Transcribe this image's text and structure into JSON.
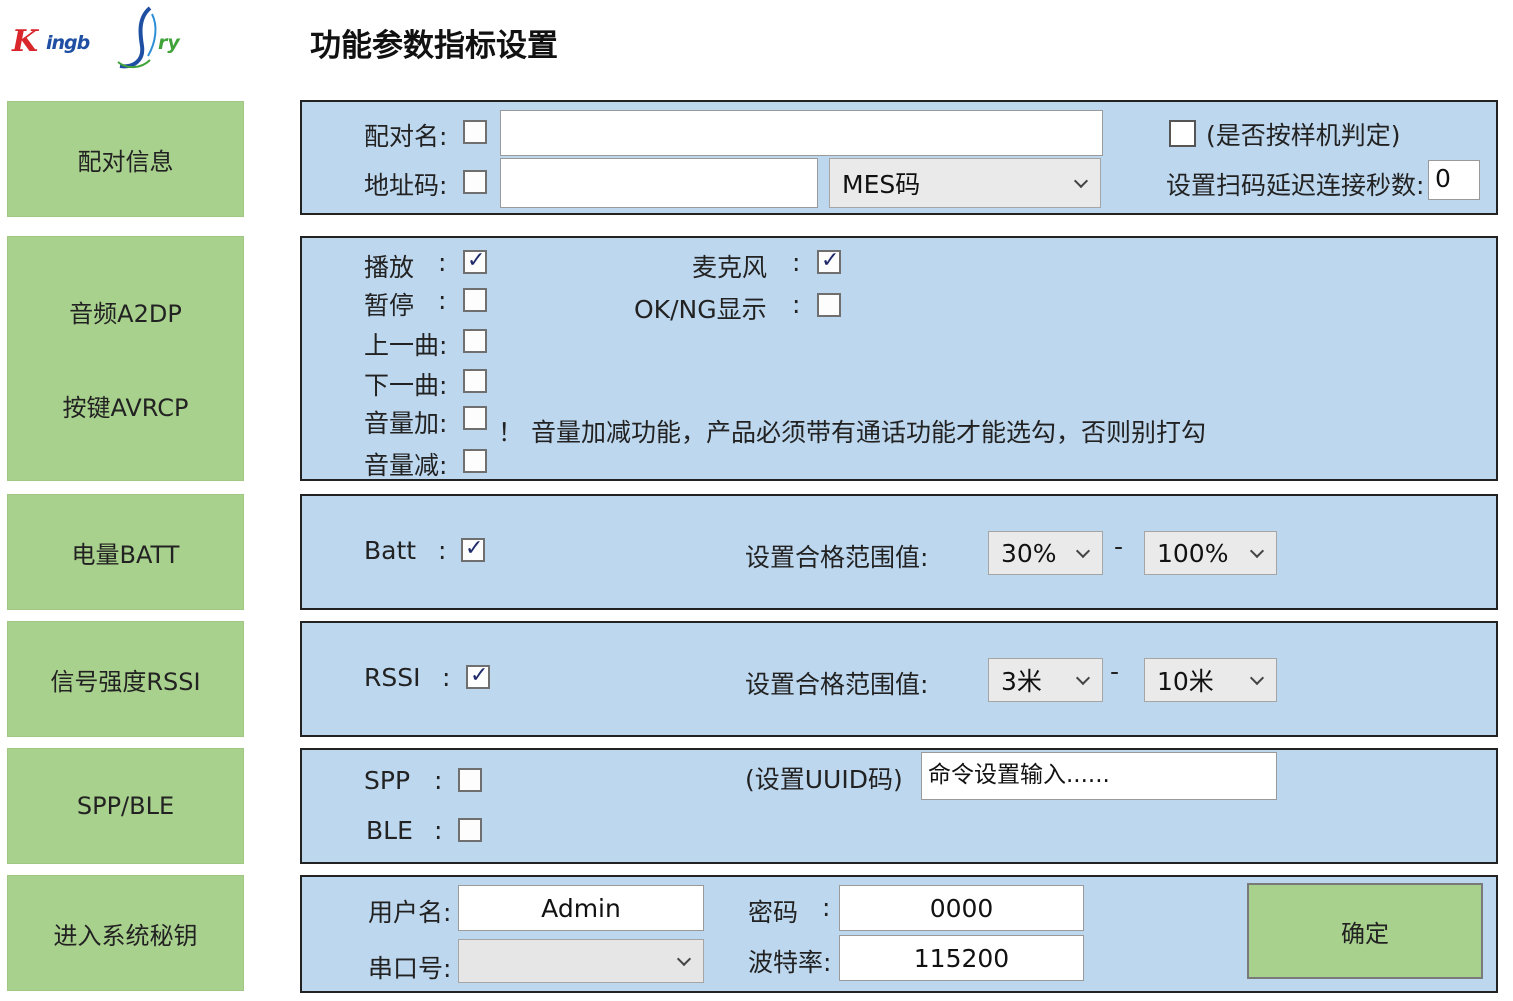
{
  "logo": {
    "k": "K",
    "ingb": "ingb",
    "j": "J",
    "ry": "ry",
    "colors": {
      "k": "#d8262b",
      "mid": "#1f4fa3",
      "ry": "#41a23a"
    }
  },
  "title": "功能参数指标设置",
  "colors": {
    "sidebar_bg": "#a9d18e",
    "panel_bg": "#bdd7ee",
    "check": "#1f2a6b"
  },
  "sidebar": {
    "pair": "配对信息",
    "audio": "音频A2DP",
    "keys": "按键AVRCP",
    "batt": "电量BATT",
    "rssi": "信号强度RSSI",
    "spp": "SPP/BLE",
    "key": "进入系统秘钥"
  },
  "pairing": {
    "name_label": "配对名:",
    "name_checked": false,
    "name_value": "",
    "addr_label": "地址码:",
    "addr_checked": false,
    "addr_value": "",
    "mes_select": "MES码",
    "sample_checked": false,
    "sample_label": "(是否按样机判定)",
    "delay_label": "设置扫码延迟连接秒数:",
    "delay_value": "0"
  },
  "audio": {
    "play_label": "播放",
    "pause_label": "暂停",
    "prev_label": "上一曲:",
    "next_label": "下一曲:",
    "volup_label": "音量加:",
    "voldown_label": "音量减:",
    "colon": ":",
    "mic_label": "麦克风",
    "okng_label": "OK/NG显示",
    "play_checked": true,
    "pause_checked": false,
    "prev_checked": false,
    "next_checked": false,
    "volup_checked": false,
    "voldown_checked": false,
    "mic_checked": true,
    "okng_checked": false,
    "warning": "！ 音量加减功能，产品必须带有通话功能才能选勾，否则别打勾"
  },
  "batt": {
    "label": "Batt",
    "colon": ":",
    "checked": true,
    "range_label": "设置合格范围值:",
    "min": "30%",
    "dash": "-",
    "max": "100%"
  },
  "rssi": {
    "label": "RSSI",
    "colon": ":",
    "checked": true,
    "range_label": "设置合格范围值:",
    "min": "3米",
    "dash": "-",
    "max": "10米"
  },
  "sppble": {
    "spp_label": "SPP",
    "ble_label": "BLE",
    "colon": ":",
    "spp_checked": false,
    "ble_checked": false,
    "uuid_label": "(设置UUID码)",
    "uuid_value": "命令设置输入......"
  },
  "login": {
    "user_label": "用户名:",
    "user_value": "Admin",
    "pwd_label": "密码",
    "pwd_colon": ":",
    "pwd_value": "0000",
    "port_label": "串口号:",
    "port_value": "",
    "baud_label": "波特率:",
    "baud_value": "115200",
    "ok_label": "确定"
  }
}
